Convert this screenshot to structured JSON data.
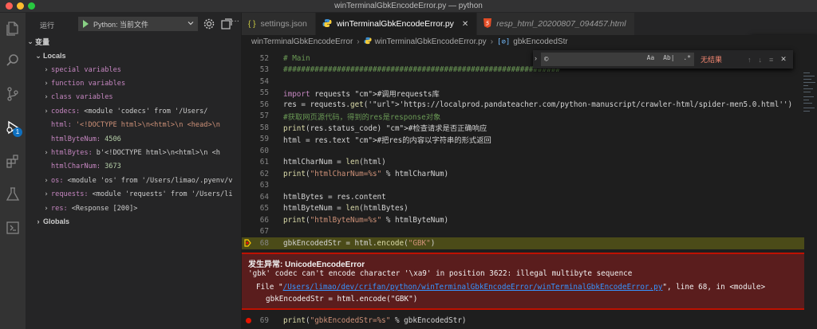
{
  "window": {
    "title": "winTerminalGbkEncodeError.py — python"
  },
  "activity_bar": {
    "items": [
      {
        "name": "explorer-icon"
      },
      {
        "name": "search-icon"
      },
      {
        "name": "source-control-icon"
      },
      {
        "name": "debug-icon",
        "badge": "1"
      },
      {
        "name": "extensions-icon"
      },
      {
        "name": "testing-icon"
      },
      {
        "name": "remote-explorer-icon"
      }
    ]
  },
  "sidebar": {
    "run_label": "运行",
    "config": "Python: 当前文件",
    "variables_header": "变量",
    "locals_header": "Locals",
    "globals_header": "Globals",
    "locals": [
      {
        "name": "special variables",
        "value": "",
        "expandable": true,
        "kind": "group"
      },
      {
        "name": "function variables",
        "value": "",
        "expandable": true,
        "kind": "group"
      },
      {
        "name": "class variables",
        "value": "",
        "expandable": true,
        "kind": "group"
      },
      {
        "name": "codecs:",
        "value": "<module 'codecs' from '/Users/",
        "expandable": true,
        "kind": "obj"
      },
      {
        "name": "html:",
        "value": "'<!DOCTYPE html>\\n<html>\\n    <head>\\n",
        "expandable": false,
        "kind": "str"
      },
      {
        "name": "htmlByteNum:",
        "value": "4506",
        "expandable": false,
        "kind": "num"
      },
      {
        "name": "htmlBytes:",
        "value": "b'<!DOCTYPE html>\\n<html>\\n    <h",
        "expandable": true,
        "kind": "obj"
      },
      {
        "name": "htmlCharNum:",
        "value": "3673",
        "expandable": false,
        "kind": "num"
      },
      {
        "name": "os:",
        "value": "<module 'os' from '/Users/limao/.pyenv/v",
        "expandable": true,
        "kind": "obj"
      },
      {
        "name": "requests:",
        "value": "<module 'requests' from '/Users/li",
        "expandable": true,
        "kind": "obj"
      },
      {
        "name": "res:",
        "value": "<Response [200]>",
        "expandable": true,
        "kind": "obj"
      }
    ]
  },
  "tabs": [
    {
      "label": "settings.json",
      "icon": "{ }",
      "icon_color": "#cbcb41",
      "active": false,
      "italic": false
    },
    {
      "label": "winTerminalGbkEncodeError.py",
      "icon": "py",
      "icon_color": "#3b8ed0",
      "active": true,
      "italic": false,
      "close": "✕"
    },
    {
      "label": "resp_html_20200807_094457.html",
      "icon": "5",
      "icon_color": "#e44d26",
      "active": false,
      "italic": true
    }
  ],
  "breadcrumb": {
    "folder": "winTerminalGbkEncodeError",
    "file": "winTerminalGbkEncodeError.py",
    "symbol": "gbkEncodedStr"
  },
  "find_widget": {
    "value": "©",
    "options": [
      "Aa",
      "Ab|",
      ".*"
    ],
    "no_results": "无结果"
  },
  "code": {
    "lines": [
      {
        "n": "52",
        "text": "# Main"
      },
      {
        "n": "53",
        "text": "##############################################################"
      },
      {
        "n": "54",
        "text": ""
      },
      {
        "n": "55",
        "text": "import requests #调用requests库"
      },
      {
        "n": "56",
        "text": "res = requests.get('https://localprod.pandateacher.com/python-manuscript/crawler-html/spider-men5.0.html')"
      },
      {
        "n": "57",
        "text": "#获取网页源代码，得到的res是response对象"
      },
      {
        "n": "58",
        "text": "print(res.status_code) #检查请求是否正确响应"
      },
      {
        "n": "59",
        "text": "html = res.text #把res的内容以字符串的形式返回"
      },
      {
        "n": "60",
        "text": ""
      },
      {
        "n": "61",
        "text": "htmlCharNum = len(html)"
      },
      {
        "n": "62",
        "text": "print(\"htmlCharNum=%s\" % htmlCharNum)"
      },
      {
        "n": "63",
        "text": ""
      },
      {
        "n": "64",
        "text": "htmlBytes = res.content"
      },
      {
        "n": "65",
        "text": "htmlByteNum = len(htmlBytes)"
      },
      {
        "n": "66",
        "text": "print(\"htmlByteNum=%s\" % htmlByteNum)"
      },
      {
        "n": "67",
        "text": ""
      },
      {
        "n": "68",
        "text": "gbkEncodedStr = html.encode(\"GBK\")"
      },
      {
        "n": "69",
        "text": "print(\"gbkEncodedStr=%s\" % gbkEncodedStr)"
      }
    ]
  },
  "exception": {
    "title": "发生异常: UnicodeEncodeError",
    "message": "'gbk' codec can't encode character '\\xa9' in position 3622: illegal multibyte sequence",
    "trace_prefix": "File \"",
    "trace_path": "/Users/limao/dev/crifan/python/winTerminalGbkEncodeError/winTerminalGbkEncodeError.py",
    "trace_suffix": "\", line 68, in <module>",
    "trace_code": "gbkEncodedStr = html.encode(\"GBK\")"
  },
  "colors": {
    "exception_bg": "#5a1d1d",
    "current_line_bg": "#4b4b18",
    "breakpoint": "#e51400",
    "accent": "#0e70c0"
  }
}
